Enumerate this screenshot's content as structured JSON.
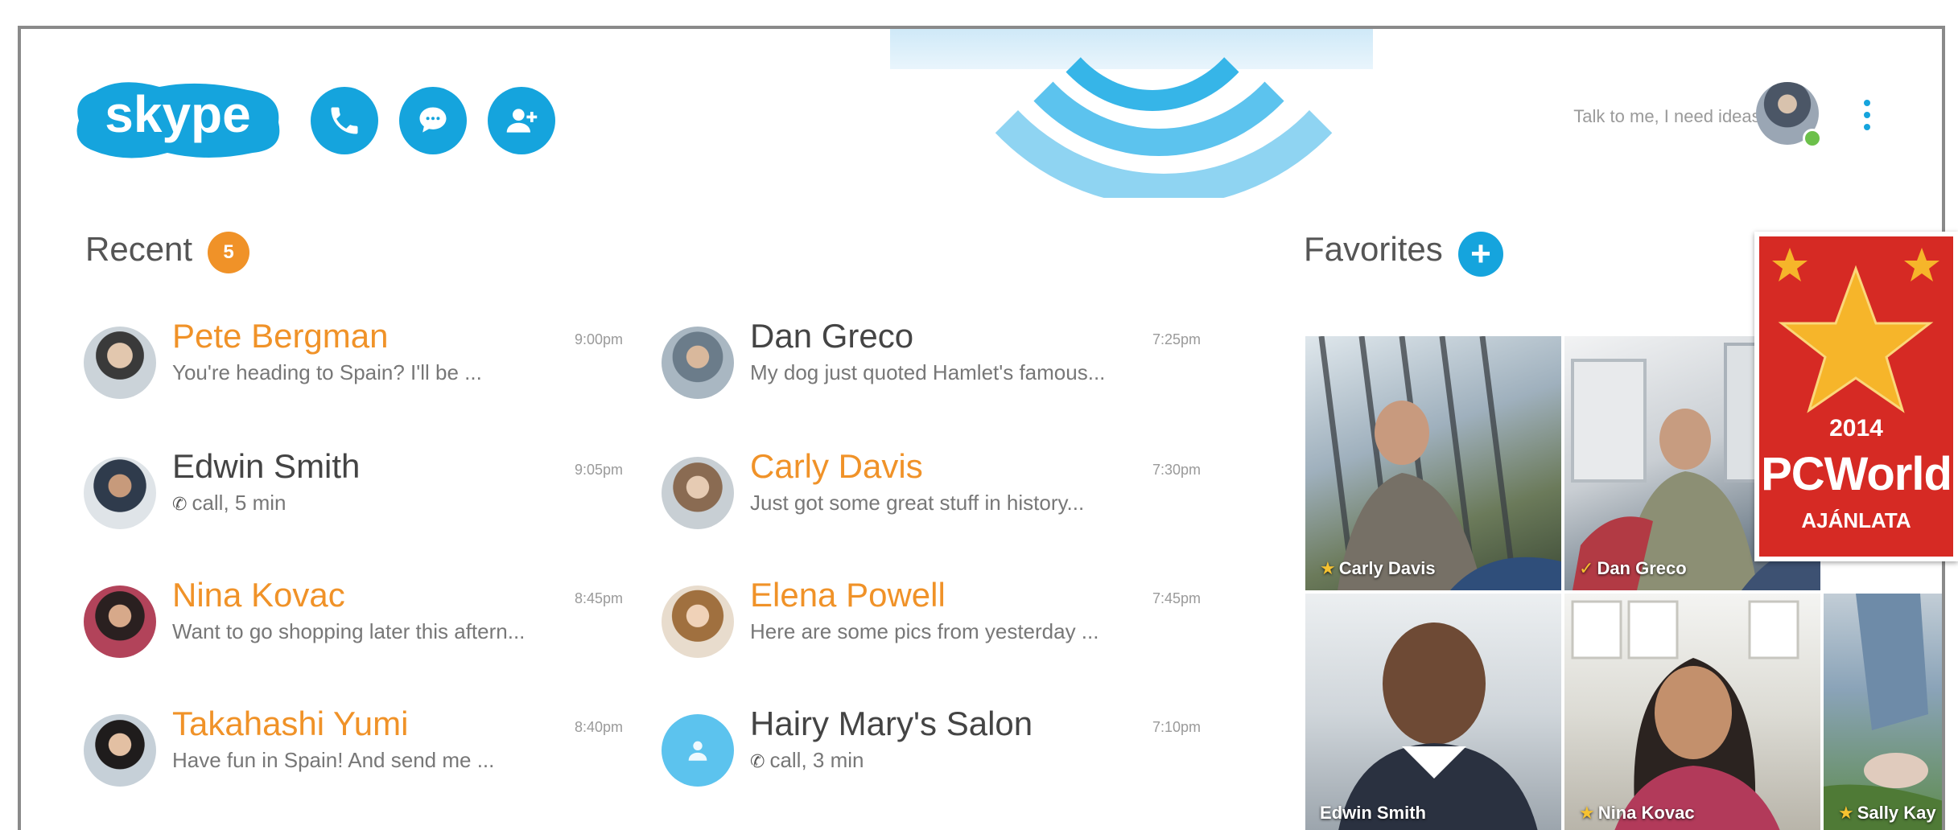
{
  "header": {
    "logo_text": "skype",
    "mood_message": "Talk to me, I need ideas...",
    "actions": [
      "call",
      "message",
      "add-contact"
    ]
  },
  "recent": {
    "title": "Recent",
    "badge": "5",
    "items": [
      {
        "name": "Pete Bergman",
        "time": "9:00pm",
        "message": "You're heading to Spain? I'll be ...",
        "unread": true,
        "call": false
      },
      {
        "name": "Dan Greco",
        "time": "7:25pm",
        "message": "My dog just quoted Hamlet's famous...",
        "unread": false,
        "call": false
      },
      {
        "name": "Edwin Smith",
        "time": "9:05pm",
        "message": "call, 5 min",
        "unread": false,
        "call": true
      },
      {
        "name": "Carly Davis",
        "time": "7:30pm",
        "message": "Just got some great stuff in history...",
        "unread": true,
        "call": false
      },
      {
        "name": "Nina Kovac",
        "time": "8:45pm",
        "message": "Want to go shopping later this aftern...",
        "unread": true,
        "call": false
      },
      {
        "name": "Elena Powell",
        "time": "7:45pm",
        "message": "Here are some pics from yesterday ...",
        "unread": true,
        "call": false
      },
      {
        "name": "Takahashi Yumi",
        "time": "8:40pm",
        "message": "Have fun in Spain! And send me ...",
        "unread": true,
        "call": false
      },
      {
        "name": "Hairy Mary's Salon",
        "time": "7:10pm",
        "message": "call, 3 min",
        "unread": false,
        "call": true
      }
    ]
  },
  "favorites": {
    "title": "Favorites",
    "tiles": [
      {
        "name": "Carly Davis",
        "status": "star"
      },
      {
        "name": "Dan Greco",
        "status": "check"
      },
      {
        "name": "Edwin Smith",
        "status": ""
      },
      {
        "name": "Nina Kovac",
        "status": "star"
      },
      {
        "name": "Sally Kay",
        "status": "star"
      }
    ]
  },
  "award": {
    "year": "2014",
    "brand": "PCWorld",
    "subtitle": "AJÁNLATA"
  },
  "colors": {
    "accent": "#15a4dd",
    "unread": "#f09228",
    "award_red": "#d62a24",
    "online": "#6cc04a"
  }
}
